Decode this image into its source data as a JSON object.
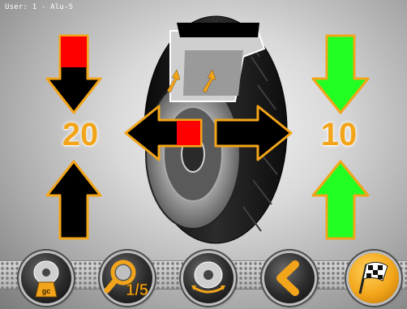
{
  "header": {
    "user_label": "User: 1 - Alu-S"
  },
  "left_plane": {
    "value": "20",
    "indicator_colors": {
      "top": "#ff0000",
      "bottom": "#000000"
    }
  },
  "right_plane": {
    "value": "10",
    "indicator_colors": {
      "top": "#22ff22",
      "bottom": "#22ff22"
    }
  },
  "direction_indicator": {
    "left_arrow_marker": "#ff0000"
  },
  "colors": {
    "value_text": "#f2a51a",
    "arrow_outline": "#f2a51a"
  },
  "toolbar": {
    "buttons": [
      {
        "icon": "balance-weight-gc-icon"
      },
      {
        "icon": "magnifier-1-5-icon"
      },
      {
        "icon": "wheel-spread-arrows-icon"
      },
      {
        "icon": "back-chevron-icon"
      },
      {
        "icon": "checkered-flag-icon"
      }
    ]
  }
}
